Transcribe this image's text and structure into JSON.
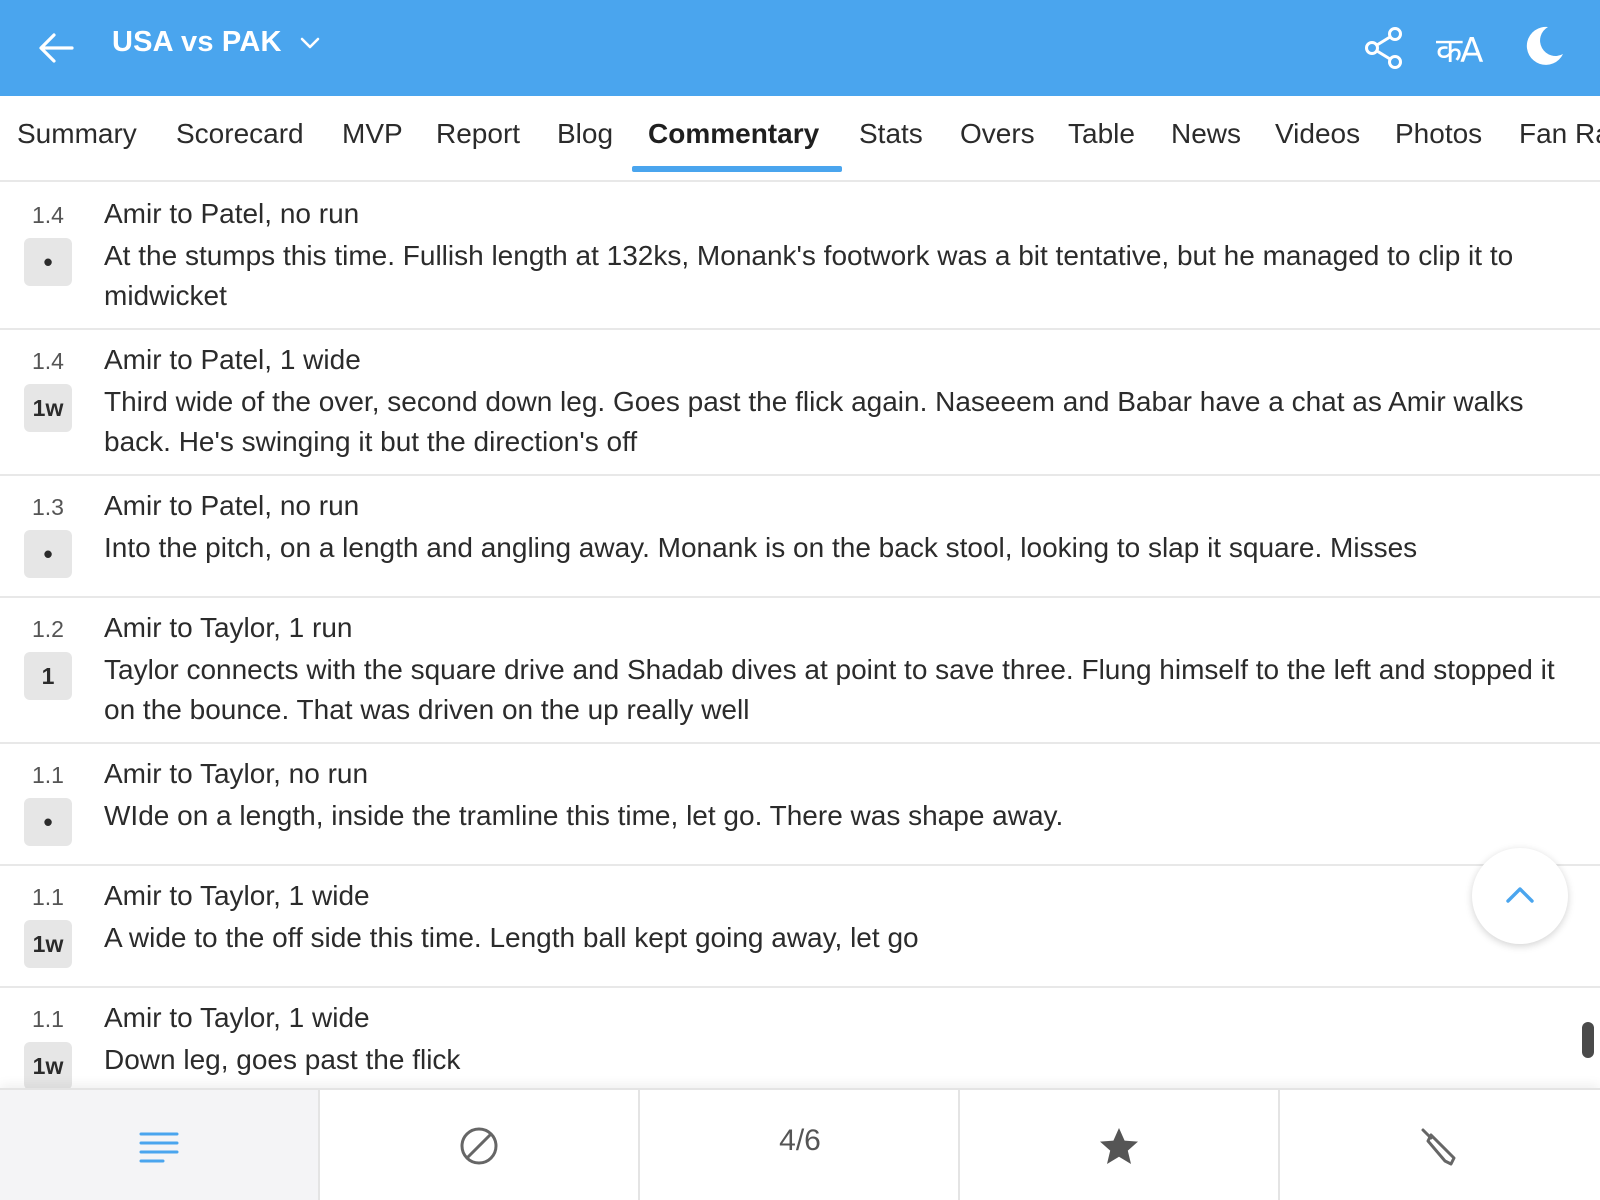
{
  "header": {
    "title": "USA vs PAK",
    "lang_label": "कA",
    "icons": [
      "back-arrow-icon",
      "chevron-down-icon",
      "share-icon",
      "language-icon",
      "moon-icon"
    ]
  },
  "tabs": [
    {
      "label": "Summary",
      "active": false
    },
    {
      "label": "Scorecard",
      "active": false
    },
    {
      "label": "MVP",
      "active": false
    },
    {
      "label": "Report",
      "active": false
    },
    {
      "label": "Blog",
      "active": false
    },
    {
      "label": "Commentary",
      "active": true
    },
    {
      "label": "Stats",
      "active": false
    },
    {
      "label": "Overs",
      "active": false
    },
    {
      "label": "Table",
      "active": false
    },
    {
      "label": "News",
      "active": false
    },
    {
      "label": "Videos",
      "active": false
    },
    {
      "label": "Photos",
      "active": false
    },
    {
      "label": "Fan Ra",
      "active": false
    }
  ],
  "commentary": [
    {
      "over": "1.4",
      "badge": "•",
      "headline": "Amir to Patel, no run",
      "text": "At the stumps this time. Fullish length at 132ks, Monank's footwork was a bit tentative, but he managed to clip it to midwicket"
    },
    {
      "over": "1.4",
      "badge": "1w",
      "headline": "Amir to Patel, 1 wide",
      "text": "Third wide of the over, second down leg. Goes past the flick again. Naseeem and Babar have a chat as Amir walks back. He's swinging it but the direction's off"
    },
    {
      "over": "1.3",
      "badge": "•",
      "headline": "Amir to Patel, no run",
      "text": "Into the pitch, on a length and angling away. Monank is on the back stool, looking to slap it square. Misses"
    },
    {
      "over": "1.2",
      "badge": "1",
      "headline": "Amir to Taylor, 1 run",
      "text": "Taylor connects with the square drive and Shadab dives at point to save three. Flung himself to the left and stopped it on the bounce. That was driven on the up really well"
    },
    {
      "over": "1.1",
      "badge": "•",
      "headline": "Amir to Taylor, no run",
      "text": "WIde on a length, inside the tramline this time, let go. There was shape away."
    },
    {
      "over": "1.1",
      "badge": "1w",
      "headline": "Amir to Taylor, 1 wide",
      "text": "A wide to the off side this time. Length ball kept going away, let go"
    },
    {
      "over": "1.1",
      "badge": "1w",
      "headline": "Amir to Taylor, 1 wide",
      "text": "Down leg, goes past the flick"
    }
  ],
  "bottom_nav": {
    "items": [
      "menu-icon",
      "ball-icon",
      "page-indicator",
      "star-icon",
      "bat-icon"
    ],
    "page_indicator": "4/6",
    "active_index": 0
  },
  "colors": {
    "accent": "#4aa5ee",
    "badge_bg": "#e6e6e6",
    "divider": "#e8e8e8"
  }
}
